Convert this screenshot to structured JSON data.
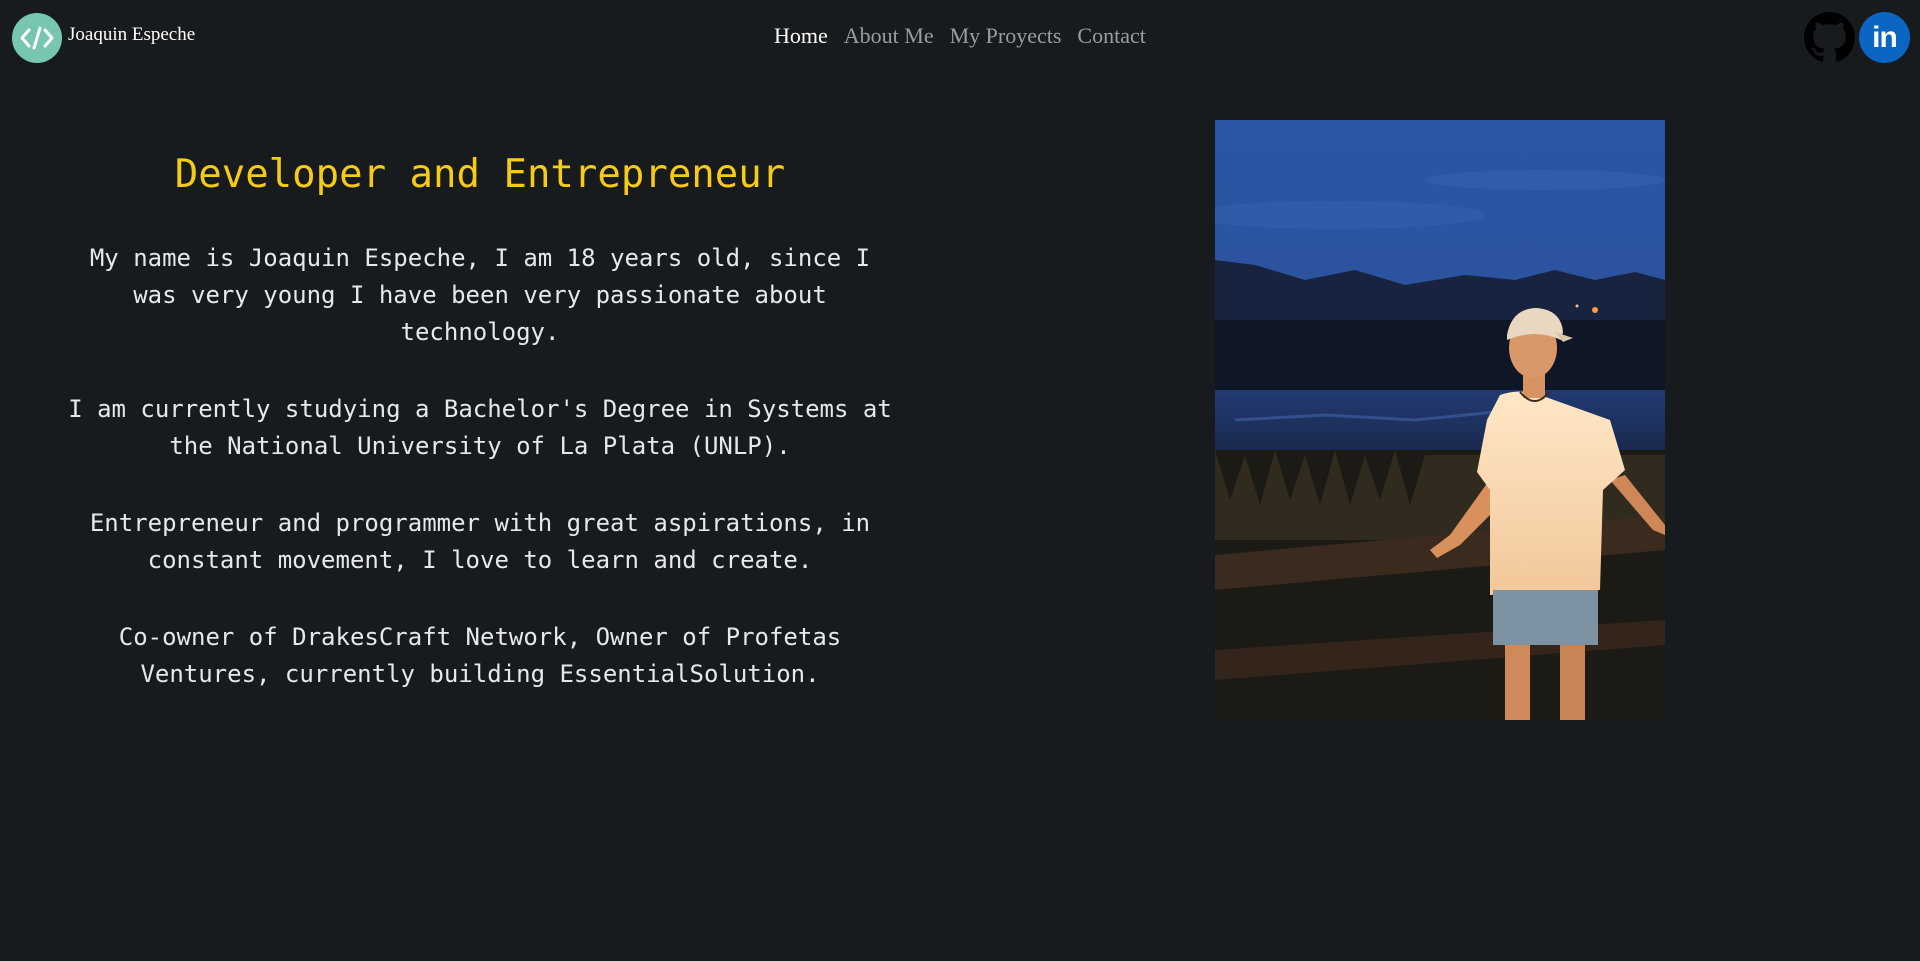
{
  "header": {
    "brand_name": "Joaquin Espeche",
    "logo_icon": "code-brackets-icon",
    "nav": [
      {
        "label": "Home",
        "active": true
      },
      {
        "label": "About Me",
        "active": false
      },
      {
        "label": "My Proyects",
        "active": false
      },
      {
        "label": "Contact",
        "active": false
      }
    ],
    "social": {
      "github_icon": "github-icon",
      "linkedin_icon": "linkedin-icon",
      "linkedin_text": "in"
    }
  },
  "main": {
    "title": "Developer and Entrepreneur",
    "paragraphs": [
      "My name is Joaquin Espeche, I am 18 years old, since I was very young I have been very passionate about technology.",
      "I am currently studying a Bachelor's Degree in Systems at the National University of La Plata (UNLP).",
      "Entrepreneur and programmer with great aspirations, in constant movement, I love to learn and create.",
      "Co-owner of DrakesCraft Network, Owner of Profetas Ventures, currently building EssentialSolution."
    ]
  },
  "colors": {
    "background": "#171b1e",
    "title": "#f5cb14",
    "logo": "#77c7b0",
    "linkedin": "#0a66c2"
  }
}
